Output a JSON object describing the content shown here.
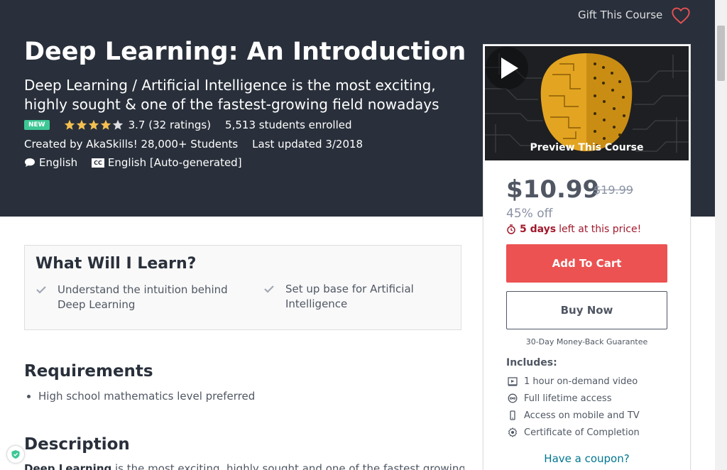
{
  "header": {
    "gift_label": "Gift This Course",
    "title": "Deep Learning: An Introduction",
    "subtitle": "Deep Learning / Artificial Intelligence is the most exciting, highly sought & one of the fastest-growing field nowadays",
    "badge": "NEW",
    "rating_value": 3.7,
    "rating_text": "3.7 (32 ratings)",
    "students": "5,513 students enrolled",
    "created_by": "Created by AkaSkills! 28,000+ Students",
    "last_updated": "Last updated 3/2018",
    "language": "English",
    "captions": "English [Auto-generated]",
    "captions_badge": "CC"
  },
  "sidebar": {
    "preview_label": "Preview This Course",
    "price": "$10.99",
    "old_price": "$19.99",
    "discount": "45% off",
    "timer_bold": "5 days",
    "timer_rest": "left at this price!",
    "add_to_cart": "Add To Cart",
    "buy_now": "Buy Now",
    "guarantee": "30-Day Money-Back Guarantee",
    "includes_title": "Includes:",
    "includes": [
      {
        "icon": "video-icon",
        "label": "1 hour on-demand video"
      },
      {
        "icon": "infinity-icon",
        "label": "Full lifetime access"
      },
      {
        "icon": "mobile-icon",
        "label": "Access on mobile and TV"
      },
      {
        "icon": "certificate-icon",
        "label": "Certificate of Completion"
      }
    ],
    "coupon": "Have a coupon?"
  },
  "main": {
    "learn_title": "What Will I Learn?",
    "learn_items": [
      "Understand the intuition behind Deep Learning",
      "Set up base for Artificial Intelligence"
    ],
    "requirements_title": "Requirements",
    "requirements": [
      "High school mathematics level preferred"
    ],
    "description_title": "Description",
    "description_bold": "Deep Learning",
    "description_rest": " is the most exciting, highly sought and one of the fastest growing field"
  },
  "colors": {
    "hero_bg": "#29303b",
    "accent_red": "#ec5252",
    "badge_green": "#3dc795",
    "star": "#f4c150",
    "link": "#007791",
    "timer": "#a1192c"
  }
}
